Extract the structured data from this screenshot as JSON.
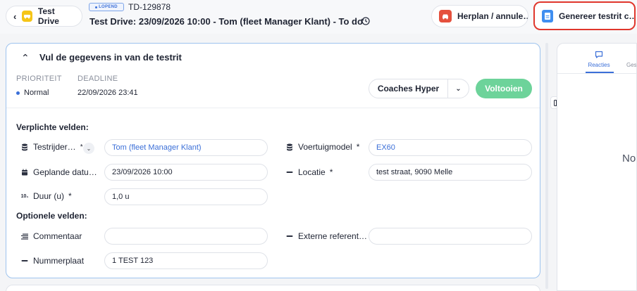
{
  "header": {
    "back_label": "Test Drive",
    "status_badge": "LOPEND",
    "ticket_id": "TD-129878",
    "title": "Test Drive: 23/09/2026 10:00 - Tom (fleet Manager Klant) - To do",
    "replan_label": "Herplan / annule…",
    "generate_label": "Genereer testrit c…"
  },
  "card": {
    "title": "Vul de gegevens in van de testrit",
    "priority_label": "PRIORITEIT",
    "priority_value": "Normal",
    "deadline_label": "DEADLINE",
    "deadline_value": "22/09/2026 23:41",
    "coach_button": "Coaches Hyper",
    "finish_button": "Voltooien",
    "required_title": "Verplichte velden:",
    "optional_title": "Optionele velden:",
    "fields": {
      "driver_label": "Testrijder…",
      "driver_value": "Tom (fleet Manager Klant)",
      "model_label": "Voertuigmodel",
      "model_value": "EX60",
      "planned_label": "Geplande datu…",
      "planned_value": "23/09/2026 10:00",
      "location_label": "Locatie",
      "location_value": "test straat, 9090 Melle",
      "duration_label": "Duur (u)",
      "duration_value": "1,0 u",
      "comment_label": "Commentaar",
      "comment_value": "",
      "external_label": "Externe referent…",
      "external_value": "",
      "plate_label": "Nummerplaat",
      "plate_value": "1 TEST 123"
    },
    "required_marker": "*"
  },
  "right_panel": {
    "tab_reacties": "Reacties",
    "tab_second": "Ges",
    "empty_text": "No"
  },
  "colors": {
    "accent": "#3b6fd8",
    "finish": "#6dd39a",
    "highlight_border": "#e0362c",
    "car_badge": "#f5c518"
  }
}
